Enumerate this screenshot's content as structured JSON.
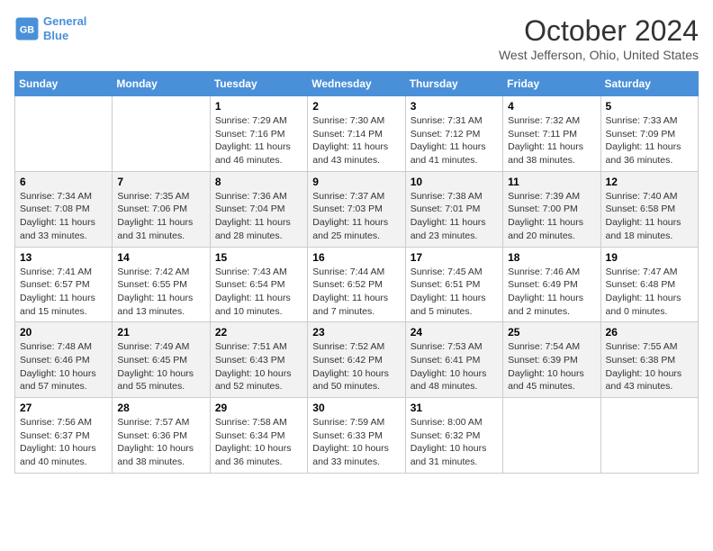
{
  "header": {
    "logo_line1": "General",
    "logo_line2": "Blue",
    "month": "October 2024",
    "location": "West Jefferson, Ohio, United States"
  },
  "days_of_week": [
    "Sunday",
    "Monday",
    "Tuesday",
    "Wednesday",
    "Thursday",
    "Friday",
    "Saturday"
  ],
  "weeks": [
    [
      {
        "num": "",
        "info": ""
      },
      {
        "num": "",
        "info": ""
      },
      {
        "num": "1",
        "info": "Sunrise: 7:29 AM\nSunset: 7:16 PM\nDaylight: 11 hours and 46 minutes."
      },
      {
        "num": "2",
        "info": "Sunrise: 7:30 AM\nSunset: 7:14 PM\nDaylight: 11 hours and 43 minutes."
      },
      {
        "num": "3",
        "info": "Sunrise: 7:31 AM\nSunset: 7:12 PM\nDaylight: 11 hours and 41 minutes."
      },
      {
        "num": "4",
        "info": "Sunrise: 7:32 AM\nSunset: 7:11 PM\nDaylight: 11 hours and 38 minutes."
      },
      {
        "num": "5",
        "info": "Sunrise: 7:33 AM\nSunset: 7:09 PM\nDaylight: 11 hours and 36 minutes."
      }
    ],
    [
      {
        "num": "6",
        "info": "Sunrise: 7:34 AM\nSunset: 7:08 PM\nDaylight: 11 hours and 33 minutes."
      },
      {
        "num": "7",
        "info": "Sunrise: 7:35 AM\nSunset: 7:06 PM\nDaylight: 11 hours and 31 minutes."
      },
      {
        "num": "8",
        "info": "Sunrise: 7:36 AM\nSunset: 7:04 PM\nDaylight: 11 hours and 28 minutes."
      },
      {
        "num": "9",
        "info": "Sunrise: 7:37 AM\nSunset: 7:03 PM\nDaylight: 11 hours and 25 minutes."
      },
      {
        "num": "10",
        "info": "Sunrise: 7:38 AM\nSunset: 7:01 PM\nDaylight: 11 hours and 23 minutes."
      },
      {
        "num": "11",
        "info": "Sunrise: 7:39 AM\nSunset: 7:00 PM\nDaylight: 11 hours and 20 minutes."
      },
      {
        "num": "12",
        "info": "Sunrise: 7:40 AM\nSunset: 6:58 PM\nDaylight: 11 hours and 18 minutes."
      }
    ],
    [
      {
        "num": "13",
        "info": "Sunrise: 7:41 AM\nSunset: 6:57 PM\nDaylight: 11 hours and 15 minutes."
      },
      {
        "num": "14",
        "info": "Sunrise: 7:42 AM\nSunset: 6:55 PM\nDaylight: 11 hours and 13 minutes."
      },
      {
        "num": "15",
        "info": "Sunrise: 7:43 AM\nSunset: 6:54 PM\nDaylight: 11 hours and 10 minutes."
      },
      {
        "num": "16",
        "info": "Sunrise: 7:44 AM\nSunset: 6:52 PM\nDaylight: 11 hours and 7 minutes."
      },
      {
        "num": "17",
        "info": "Sunrise: 7:45 AM\nSunset: 6:51 PM\nDaylight: 11 hours and 5 minutes."
      },
      {
        "num": "18",
        "info": "Sunrise: 7:46 AM\nSunset: 6:49 PM\nDaylight: 11 hours and 2 minutes."
      },
      {
        "num": "19",
        "info": "Sunrise: 7:47 AM\nSunset: 6:48 PM\nDaylight: 11 hours and 0 minutes."
      }
    ],
    [
      {
        "num": "20",
        "info": "Sunrise: 7:48 AM\nSunset: 6:46 PM\nDaylight: 10 hours and 57 minutes."
      },
      {
        "num": "21",
        "info": "Sunrise: 7:49 AM\nSunset: 6:45 PM\nDaylight: 10 hours and 55 minutes."
      },
      {
        "num": "22",
        "info": "Sunrise: 7:51 AM\nSunset: 6:43 PM\nDaylight: 10 hours and 52 minutes."
      },
      {
        "num": "23",
        "info": "Sunrise: 7:52 AM\nSunset: 6:42 PM\nDaylight: 10 hours and 50 minutes."
      },
      {
        "num": "24",
        "info": "Sunrise: 7:53 AM\nSunset: 6:41 PM\nDaylight: 10 hours and 48 minutes."
      },
      {
        "num": "25",
        "info": "Sunrise: 7:54 AM\nSunset: 6:39 PM\nDaylight: 10 hours and 45 minutes."
      },
      {
        "num": "26",
        "info": "Sunrise: 7:55 AM\nSunset: 6:38 PM\nDaylight: 10 hours and 43 minutes."
      }
    ],
    [
      {
        "num": "27",
        "info": "Sunrise: 7:56 AM\nSunset: 6:37 PM\nDaylight: 10 hours and 40 minutes."
      },
      {
        "num": "28",
        "info": "Sunrise: 7:57 AM\nSunset: 6:36 PM\nDaylight: 10 hours and 38 minutes."
      },
      {
        "num": "29",
        "info": "Sunrise: 7:58 AM\nSunset: 6:34 PM\nDaylight: 10 hours and 36 minutes."
      },
      {
        "num": "30",
        "info": "Sunrise: 7:59 AM\nSunset: 6:33 PM\nDaylight: 10 hours and 33 minutes."
      },
      {
        "num": "31",
        "info": "Sunrise: 8:00 AM\nSunset: 6:32 PM\nDaylight: 10 hours and 31 minutes."
      },
      {
        "num": "",
        "info": ""
      },
      {
        "num": "",
        "info": ""
      }
    ]
  ]
}
